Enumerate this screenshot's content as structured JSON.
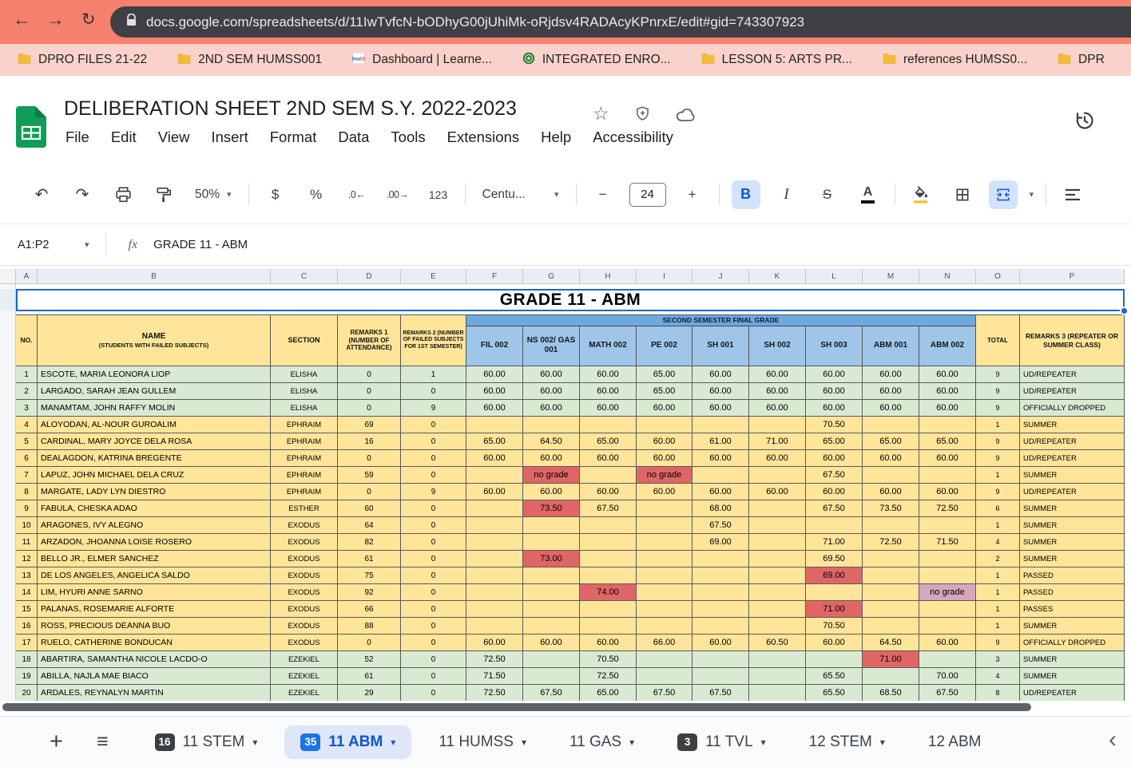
{
  "browser": {
    "url": "docs.google.com/spreadsheets/d/11IwTvfcN-bODhyG00jUhiMk-oRjdsv4RADAcyKPnrxE/edit#gid=743307923",
    "bookmarks": [
      {
        "label": "DPRO FILES 21-22",
        "icon": "folder-icon"
      },
      {
        "label": "2ND SEM HUMSS001",
        "icon": "folder-icon"
      },
      {
        "label": "Dashboard | Learne...",
        "icon": "deped-icon"
      },
      {
        "label": "INTEGRATED ENRO...",
        "icon": "seal-icon"
      },
      {
        "label": "LESSON 5: ARTS PR...",
        "icon": "folder-icon"
      },
      {
        "label": "references HUMSS0...",
        "icon": "folder-icon"
      },
      {
        "label": "DPR",
        "icon": "folder-icon"
      }
    ]
  },
  "app": {
    "title": "DELIBERATION SHEET 2ND SEM S.Y. 2022-2023",
    "menus": [
      "File",
      "Edit",
      "View",
      "Insert",
      "Format",
      "Data",
      "Tools",
      "Extensions",
      "Help",
      "Accessibility"
    ]
  },
  "toolbar": {
    "zoom": "50%",
    "currency": "$",
    "percent": "%",
    "decimal_decrease": ".0←",
    "decimal_increase": ".00→",
    "number_format": "123",
    "font_name": "Centu...",
    "font_size_decrease": "−",
    "font_size": "24",
    "font_size_increase": "+",
    "bold": "B",
    "italic": "I",
    "strikethrough": "S",
    "text_color": "A"
  },
  "formula_bar": {
    "range": "A1:P2",
    "fx_label": "fx",
    "value": "GRADE 11 - ABM"
  },
  "sheet": {
    "column_letters": [
      "A",
      "B",
      "C",
      "D",
      "E",
      "F",
      "G",
      "H",
      "I",
      "J",
      "K",
      "L",
      "M",
      "N",
      "O",
      "P"
    ],
    "title": "GRADE 11 - ABM",
    "header": {
      "no": "NO.",
      "name_line1": "NAME",
      "name_line2": "(STUDENTS WITH FAILED SUBJECTS)",
      "section": "SECTION",
      "remarks1": "REMARKS 1 (NUMBER OF ATTENDANCE)",
      "remarks2": "REMARKS 2 (NUMBER OF FAILED SUBJECTS FOR 1ST SEMESTER)",
      "band": "SECOND SEMESTER FINAL GRADE",
      "subjects": [
        "FIL 002",
        "NS 002/ GAS 001",
        "MATH 002",
        "PE 002",
        "SH 001",
        "SH 002",
        "SH 003",
        "ABM 001",
        "ABM 002"
      ],
      "total": "TOTAL",
      "remarks3": "REMARKS 3 (REPEATER OR SUMMER CLASS)"
    },
    "rows": [
      {
        "no": "1",
        "name": "ESCOTE, MARIA LEONORA LIOP",
        "section": "ELISHA",
        "remarks1": "0",
        "remarks2": "1",
        "grades": [
          "60.00",
          "60.00",
          "60.00",
          "65.00",
          "60.00",
          "60.00",
          "60.00",
          "60.00",
          "60.00"
        ],
        "total": "9",
        "remarks3": "UD/REPEATER",
        "tone": "green",
        "red": [],
        "pink": []
      },
      {
        "no": "2",
        "name": "LARGADO, SARAH JEAN GULLEM",
        "section": "ELISHA",
        "remarks1": "0",
        "remarks2": "0",
        "grades": [
          "60.00",
          "60.00",
          "60.00",
          "65.00",
          "60.00",
          "60.00",
          "60.00",
          "60.00",
          "60.00"
        ],
        "total": "9",
        "remarks3": "UD/REPEATER",
        "tone": "green",
        "red": [],
        "pink": []
      },
      {
        "no": "3",
        "name": "MANAMTAM, JOHN RAFFY MOLIN",
        "section": "ELISHA",
        "remarks1": "0",
        "remarks2": "9",
        "grades": [
          "60.00",
          "60.00",
          "60.00",
          "60.00",
          "60.00",
          "60.00",
          "60.00",
          "60.00",
          "60.00"
        ],
        "total": "9",
        "remarks3": "OFFICIALLY DROPPED",
        "tone": "green",
        "red": [],
        "pink": []
      },
      {
        "no": "4",
        "name": "ALOYODAN, AL-NOUR GUROALIM",
        "section": "EPHRAIM",
        "remarks1": "69",
        "remarks2": "0",
        "grades": [
          "",
          "",
          "",
          "",
          "",
          "",
          "70.50",
          "",
          ""
        ],
        "total": "1",
        "remarks3": "SUMMER",
        "tone": "yellow",
        "red": [],
        "pink": []
      },
      {
        "no": "5",
        "name": "CARDINAL, MARY JOYCE DELA ROSA",
        "section": "EPHRAIM",
        "remarks1": "16",
        "remarks2": "0",
        "grades": [
          "65.00",
          "64.50",
          "65.00",
          "60.00",
          "61.00",
          "71.00",
          "65.00",
          "65.00",
          "65.00"
        ],
        "total": "9",
        "remarks3": "UD/REPEATER",
        "tone": "yellow",
        "red": [],
        "pink": []
      },
      {
        "no": "6",
        "name": "DEALAGDON, KATRINA BREGENTE",
        "section": "EPHRAIM",
        "remarks1": "0",
        "remarks2": "0",
        "grades": [
          "60.00",
          "60.00",
          "60.00",
          "60.00",
          "60.00",
          "60.00",
          "60.00",
          "60.00",
          "60.00"
        ],
        "total": "9",
        "remarks3": "UD/REPEATER",
        "tone": "yellow",
        "red": [],
        "pink": []
      },
      {
        "no": "7",
        "name": "LAPUZ, JOHN MICHAEL DELA CRUZ",
        "section": "EPHRAIM",
        "remarks1": "59",
        "remarks2": "0",
        "grades": [
          "",
          "no grade",
          "",
          "no grade",
          "",
          "",
          "67.50",
          "",
          ""
        ],
        "total": "1",
        "remarks3": "SUMMER",
        "tone": "yellow",
        "red": [
          1,
          3
        ],
        "pink": []
      },
      {
        "no": "8",
        "name": "MARGATE, LADY LYN DIESTRO",
        "section": "EPHRAIM",
        "remarks1": "0",
        "remarks2": "9",
        "grades": [
          "60.00",
          "60.00",
          "60.00",
          "60.00",
          "60.00",
          "60.00",
          "60.00",
          "60.00",
          "60.00"
        ],
        "total": "9",
        "remarks3": "UD/REPEATER",
        "tone": "yellow",
        "red": [],
        "pink": []
      },
      {
        "no": "9",
        "name": "FABULA, CHESKA ADAO",
        "section": "ESTHER",
        "remarks1": "60",
        "remarks2": "0",
        "grades": [
          "",
          "73.50",
          "67.50",
          "",
          "68.00",
          "",
          "67.50",
          "73.50",
          "72.50"
        ],
        "total": "6",
        "remarks3": "SUMMER",
        "tone": "yellow",
        "red": [
          1
        ],
        "pink": []
      },
      {
        "no": "10",
        "name": "ARAGONES, IVY ALEGNO",
        "section": "EXODUS",
        "remarks1": "64",
        "remarks2": "0",
        "grades": [
          "",
          "",
          "",
          "",
          "67.50",
          "",
          "",
          "",
          ""
        ],
        "total": "1",
        "remarks3": "SUMMER",
        "tone": "yellow",
        "red": [],
        "pink": []
      },
      {
        "no": "11",
        "name": "ARZADON, JHOANNA LOISE ROSERO",
        "section": "EXODUS",
        "remarks1": "82",
        "remarks2": "0",
        "grades": [
          "",
          "",
          "",
          "",
          "69.00",
          "",
          "71.00",
          "72.50",
          "71.50"
        ],
        "total": "4",
        "remarks3": "SUMMER",
        "tone": "yellow",
        "red": [],
        "pink": []
      },
      {
        "no": "12",
        "name": "BELLO JR., ELMER SANCHEZ",
        "section": "EXODUS",
        "remarks1": "61",
        "remarks2": "0",
        "grades": [
          "",
          "73.00",
          "",
          "",
          "",
          "",
          "69.50",
          "",
          ""
        ],
        "total": "2",
        "remarks3": "SUMMER",
        "tone": "yellow",
        "red": [
          1
        ],
        "pink": []
      },
      {
        "no": "13",
        "name": "DE LOS ANGELES, ANGELICA SALDO",
        "section": "EXODUS",
        "remarks1": "75",
        "remarks2": "0",
        "grades": [
          "",
          "",
          "",
          "",
          "",
          "",
          "69.00",
          "",
          ""
        ],
        "total": "1",
        "remarks3": "PASSED",
        "tone": "yellow",
        "red": [
          6
        ],
        "pink": []
      },
      {
        "no": "14",
        "name": "LIM, HYURI ANNE SARNO",
        "section": "EXODUS",
        "remarks1": "92",
        "remarks2": "0",
        "grades": [
          "",
          "",
          "74.00",
          "",
          "",
          "",
          "",
          "",
          "no grade"
        ],
        "total": "1",
        "remarks3": "PASSED",
        "tone": "yellow",
        "red": [
          2
        ],
        "pink": [
          8
        ]
      },
      {
        "no": "15",
        "name": "PALANAS, ROSEMARIE ALFORTE",
        "section": "EXODUS",
        "remarks1": "66",
        "remarks2": "0",
        "grades": [
          "",
          "",
          "",
          "",
          "",
          "",
          "71.00",
          "",
          ""
        ],
        "total": "1",
        "remarks3": "PASSES",
        "tone": "yellow",
        "red": [
          6
        ],
        "pink": []
      },
      {
        "no": "16",
        "name": "ROSS, PRECIOUS DEANNA BUO",
        "section": "EXODUS",
        "remarks1": "88",
        "remarks2": "0",
        "grades": [
          "",
          "",
          "",
          "",
          "",
          "",
          "70.50",
          "",
          ""
        ],
        "total": "1",
        "remarks3": "SUMMER",
        "tone": "yellow",
        "red": [],
        "pink": []
      },
      {
        "no": "17",
        "name": "RUELO, CATHERINE BONDUCAN",
        "section": "EXODUS",
        "remarks1": "0",
        "remarks2": "0",
        "grades": [
          "60.00",
          "60.00",
          "60.00",
          "66.00",
          "60.00",
          "60.50",
          "60.00",
          "64.50",
          "60.00"
        ],
        "total": "9",
        "remarks3": "OFFICIALLY DROPPED",
        "tone": "yellow",
        "red": [],
        "pink": []
      },
      {
        "no": "18",
        "name": "ABARTIRA, SAMANTHA NICOLE LACDO-O",
        "section": "EZEKIEL",
        "remarks1": "52",
        "remarks2": "0",
        "grades": [
          "72.50",
          "",
          "70.50",
          "",
          "",
          "",
          "",
          "71.00",
          ""
        ],
        "total": "3",
        "remarks3": "SUMMER",
        "tone": "green",
        "red": [
          7
        ],
        "pink": []
      },
      {
        "no": "19",
        "name": "ABILLA, NAJLA MAE BIACO",
        "section": "EZEKIEL",
        "remarks1": "61",
        "remarks2": "0",
        "grades": [
          "71.50",
          "",
          "72.50",
          "",
          "",
          "",
          "65.50",
          "",
          "70.00"
        ],
        "total": "4",
        "remarks3": "SUMMER",
        "tone": "green",
        "red": [],
        "pink": []
      },
      {
        "no": "20",
        "name": "ARDALES, REYNALYN MARTIN",
        "section": "EZEKIEL",
        "remarks1": "29",
        "remarks2": "0",
        "grades": [
          "72.50",
          "67.50",
          "65.00",
          "67.50",
          "67.50",
          "",
          "65.50",
          "68.50",
          "67.50"
        ],
        "total": "8",
        "remarks3": "UD/REPEATER",
        "tone": "green",
        "red": [],
        "pink": []
      }
    ]
  },
  "tabs": {
    "items": [
      {
        "badge": "16",
        "label": "11 STEM",
        "active": false,
        "caret": true
      },
      {
        "badge": "35",
        "label": "11 ABM",
        "active": true,
        "caret": true
      },
      {
        "badge": "",
        "label": "11 HUMSS",
        "active": false,
        "caret": true
      },
      {
        "badge": "",
        "label": "11 GAS",
        "active": false,
        "caret": true
      },
      {
        "badge": "3",
        "label": "11 TVL",
        "active": false,
        "caret": true
      },
      {
        "badge": "",
        "label": "12 STEM",
        "active": false,
        "caret": true
      },
      {
        "badge": "",
        "label": "12 ABM",
        "active": false,
        "caret": false
      }
    ]
  },
  "colors": {
    "accent_blue": "#1a73e8",
    "selection_border": "#1967d2",
    "row_green": "#d9ead3",
    "row_yellow": "#ffe599",
    "cell_red": "#e06666",
    "cell_pink": "#d5a6bd",
    "header_blue": "#9fc5e8",
    "band_blue": "#6fa8dc",
    "topbar_salmon": "#f4806e",
    "bookmarks_pink": "#f8d2cb"
  }
}
